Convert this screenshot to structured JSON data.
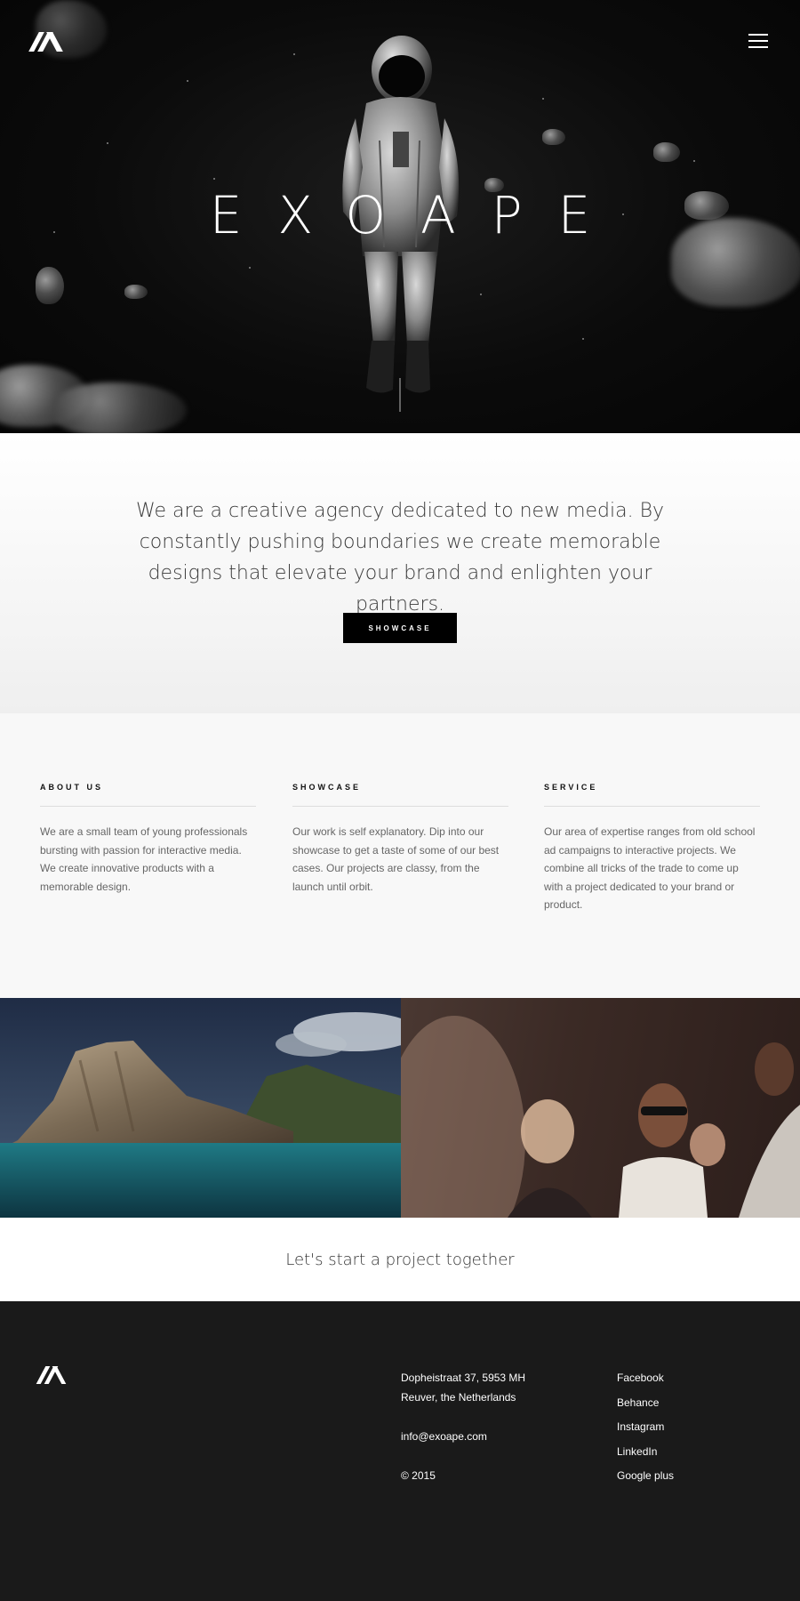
{
  "hero": {
    "brand": "EXOAPE",
    "menu_icon": "hamburger-icon",
    "logo_icon": "brand-logo-icon",
    "scroll_icon": "scroll-down-arrow-icon"
  },
  "intro": {
    "text": "We are a creative agency dedicated to new media. By constantly pushing boundaries we create memorable designs that elevate your brand and enlighten your partners.",
    "button_label": "SHOWCASE"
  },
  "features": [
    {
      "title": "ABOUT US",
      "body": "We are a small team of young professionals bursting with passion for interactive media. We create innovative products with a memorable design."
    },
    {
      "title": "SHOWCASE",
      "body": "Our work is self explanatory. Dip into our showcase to get a taste of some of our best cases. Our projects are classy, from the launch until orbit."
    },
    {
      "title": "SERVICE",
      "body": "Our area of expertise ranges from old school ad campaigns to interactive projects. We combine all tricks of the trade to come up with a project dedicated to your brand or product."
    }
  ],
  "cta": {
    "label": "Let's start a project together"
  },
  "footer": {
    "address_line1": "Dopheistraat 37, 5953 MH",
    "address_line2": "Reuver, the Netherlands",
    "email": "info@exoape.com",
    "copyright": "© 2015",
    "social": [
      "Facebook",
      "Behance",
      "Instagram",
      "LinkedIn",
      "Google plus"
    ]
  },
  "colors": {
    "hero_bg": "#0b0b0b",
    "button_bg": "#000000",
    "footer_bg": "#1a1a1a",
    "features_bg": "#f8f8f8"
  }
}
